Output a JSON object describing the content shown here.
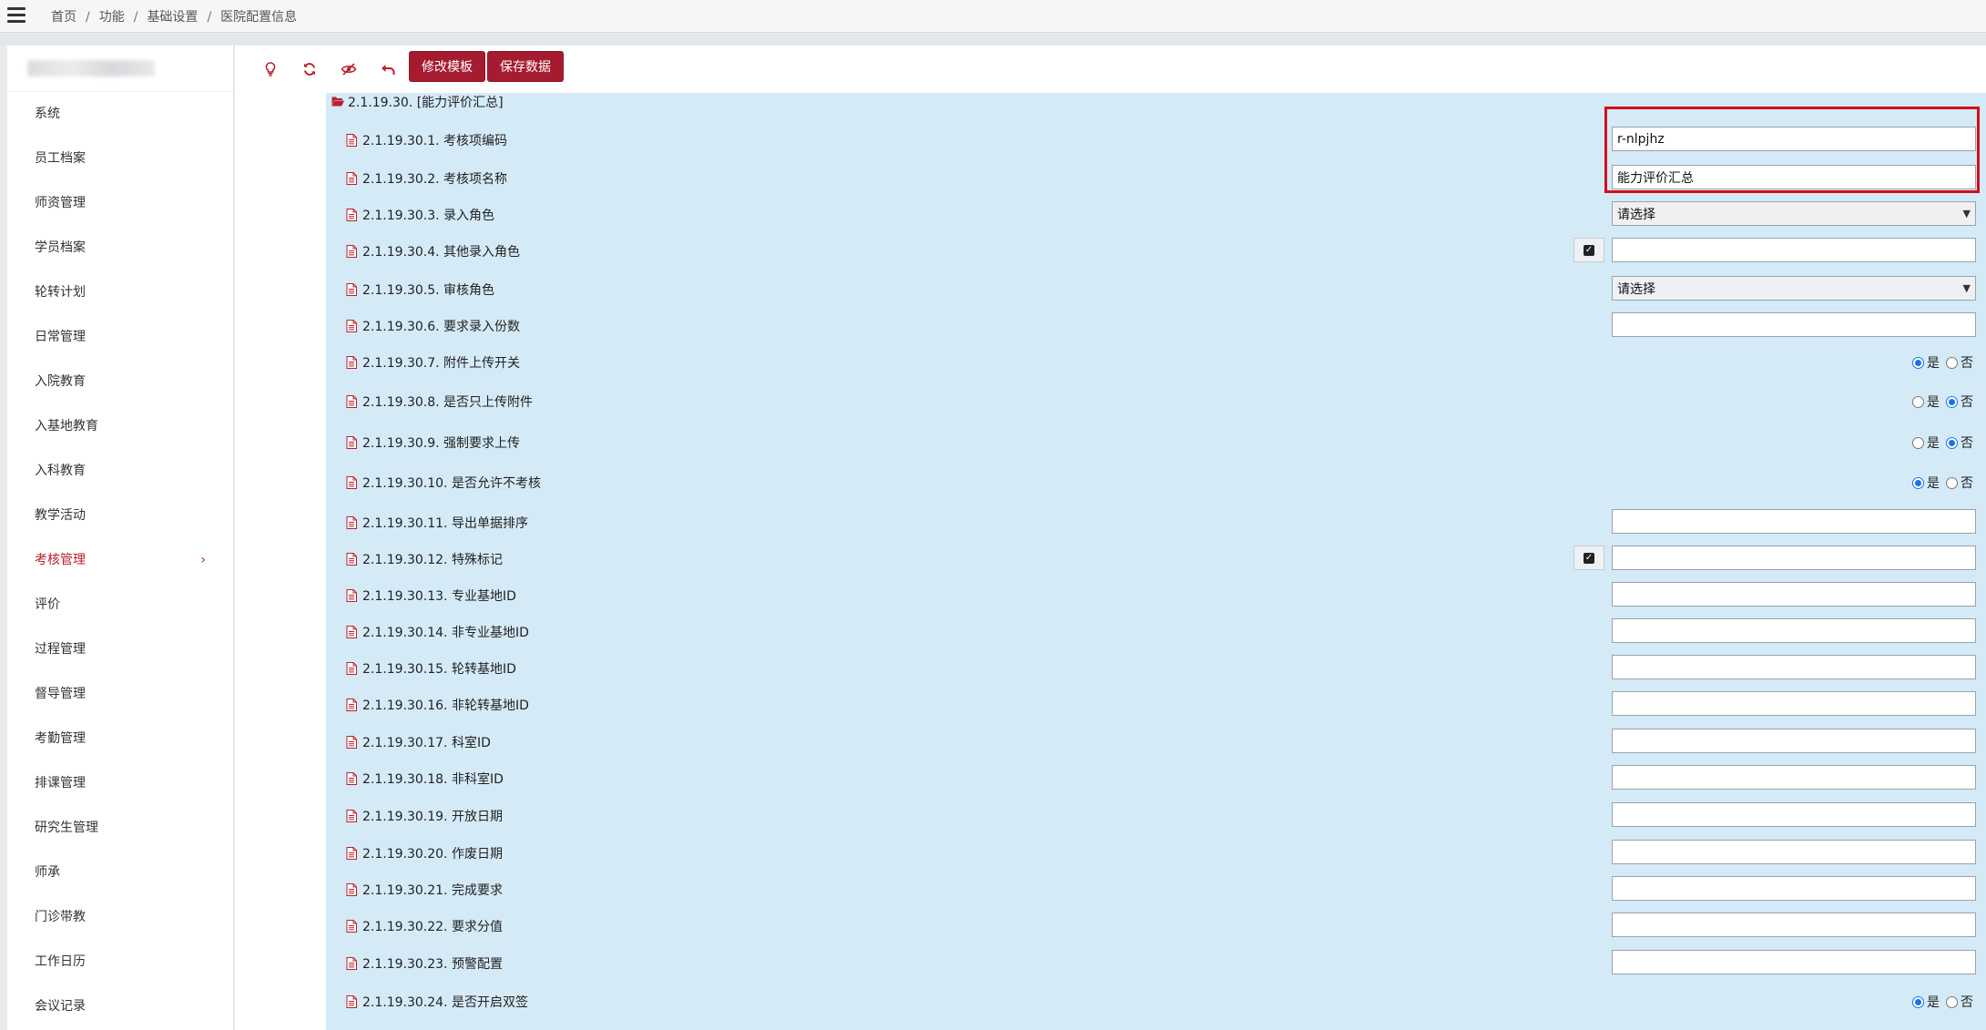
{
  "breadcrumb": [
    "首页",
    "功能",
    "基础设置",
    "医院配置信息"
  ],
  "sidebar": {
    "items": [
      {
        "label": "系统",
        "active": false
      },
      {
        "label": "员工档案",
        "active": false
      },
      {
        "label": "师资管理",
        "active": false
      },
      {
        "label": "学员档案",
        "active": false
      },
      {
        "label": "轮转计划",
        "active": false
      },
      {
        "label": "日常管理",
        "active": false
      },
      {
        "label": "入院教育",
        "active": false
      },
      {
        "label": "入基地教育",
        "active": false
      },
      {
        "label": "入科教育",
        "active": false
      },
      {
        "label": "教学活动",
        "active": false
      },
      {
        "label": "考核管理",
        "active": true
      },
      {
        "label": "评价",
        "active": false
      },
      {
        "label": "过程管理",
        "active": false
      },
      {
        "label": "督导管理",
        "active": false
      },
      {
        "label": "考勤管理",
        "active": false
      },
      {
        "label": "排课管理",
        "active": false
      },
      {
        "label": "研究生管理",
        "active": false
      },
      {
        "label": "师承",
        "active": false
      },
      {
        "label": "门诊带教",
        "active": false
      },
      {
        "label": "工作日历",
        "active": false
      },
      {
        "label": "会议记录",
        "active": false
      }
    ]
  },
  "toolbar": {
    "icons": [
      "lightbulb-icon",
      "refresh-icon",
      "eye-slash-icon",
      "undo-icon"
    ],
    "edit_template_label": "修改模板",
    "save_data_label": "保存数据"
  },
  "section": {
    "title": "2.1.19.30. [能力评价汇总]",
    "fields": [
      {
        "label": "2.1.19.30.1. 考核项编码",
        "type": "text",
        "value": "r-nlpjhz"
      },
      {
        "label": "2.1.19.30.2. 考核项名称",
        "type": "text",
        "value": "能力评价汇总"
      },
      {
        "label": "2.1.19.30.3. 录入角色",
        "type": "select",
        "value": "请选择"
      },
      {
        "label": "2.1.19.30.4. 其他录入角色",
        "type": "check-text",
        "value": ""
      },
      {
        "label": "2.1.19.30.5. 审核角色",
        "type": "select",
        "value": "请选择"
      },
      {
        "label": "2.1.19.30.6. 要求录入份数",
        "type": "text",
        "value": ""
      },
      {
        "label": "2.1.19.30.7. 附件上传开关",
        "type": "radio",
        "value": "是"
      },
      {
        "label": "2.1.19.30.8. 是否只上传附件",
        "type": "radio",
        "value": "否"
      },
      {
        "label": "2.1.19.30.9. 强制要求上传",
        "type": "radio",
        "value": "否"
      },
      {
        "label": "2.1.19.30.10. 是否允许不考核",
        "type": "radio",
        "value": "是"
      },
      {
        "label": "2.1.19.30.11. 导出单据排序",
        "type": "text",
        "value": ""
      },
      {
        "label": "2.1.19.30.12. 特殊标记",
        "type": "check-text",
        "value": ""
      },
      {
        "label": "2.1.19.30.13. 专业基地ID",
        "type": "text",
        "value": ""
      },
      {
        "label": "2.1.19.30.14. 非专业基地ID",
        "type": "text",
        "value": ""
      },
      {
        "label": "2.1.19.30.15. 轮转基地ID",
        "type": "text",
        "value": ""
      },
      {
        "label": "2.1.19.30.16. 非轮转基地ID",
        "type": "text",
        "value": ""
      },
      {
        "label": "2.1.19.30.17. 科室ID",
        "type": "text",
        "value": ""
      },
      {
        "label": "2.1.19.30.18. 非科室ID",
        "type": "text",
        "value": ""
      },
      {
        "label": "2.1.19.30.19. 开放日期",
        "type": "text",
        "value": ""
      },
      {
        "label": "2.1.19.30.20. 作废日期",
        "type": "text",
        "value": ""
      },
      {
        "label": "2.1.19.30.21. 完成要求",
        "type": "text",
        "value": ""
      },
      {
        "label": "2.1.19.30.22. 要求分值",
        "type": "text",
        "value": ""
      },
      {
        "label": "2.1.19.30.23. 预警配置",
        "type": "text",
        "value": ""
      },
      {
        "label": "2.1.19.30.24. 是否开启双签",
        "type": "radio",
        "value": "是"
      }
    ],
    "radio_yes": "是",
    "radio_no": "否"
  },
  "colors": {
    "accent": "#a51c30",
    "active_menu": "#b8202e",
    "content_bg": "#d4eaf7",
    "highlight_border": "#d0101a"
  }
}
